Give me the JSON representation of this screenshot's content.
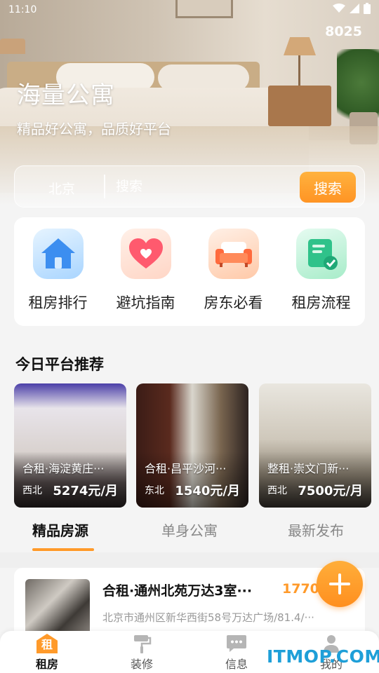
{
  "status_bar": {
    "time": "11:10"
  },
  "header": {
    "count": "8025",
    "title": "海量公寓",
    "subtitle": "精品好公寓，品质好平台"
  },
  "search": {
    "city": "北京",
    "placeholder": "搜索",
    "button_label": "搜索"
  },
  "categories": [
    {
      "label": "租房排行",
      "icon": "house-icon"
    },
    {
      "label": "避坑指南",
      "icon": "heart-icon"
    },
    {
      "label": "房东必看",
      "icon": "sofa-icon"
    },
    {
      "label": "租房流程",
      "icon": "checklist-icon"
    }
  ],
  "recommend": {
    "title": "今日平台推荐",
    "items": [
      {
        "title": "合租·海淀黄庄···",
        "direction": "西北",
        "price": "5274元/月"
      },
      {
        "title": "合租·昌平沙河···",
        "direction": "东北",
        "price": "1540元/月"
      },
      {
        "title": "整租·崇文门新···",
        "direction": "西北",
        "price": "7500元/月"
      }
    ]
  },
  "tabs": [
    {
      "label": "精品房源",
      "active": true
    },
    {
      "label": "单身公寓",
      "active": false
    },
    {
      "label": "最新发布",
      "active": false
    }
  ],
  "listing": {
    "title": "合租·通州北苑万达3室···",
    "price": "1770",
    "address": "北京市通州区新华西街58号万达广场/81.4/···"
  },
  "bottom_nav": [
    {
      "label": "租房",
      "badge": "租",
      "active": true
    },
    {
      "label": "装修",
      "active": false
    },
    {
      "label": "信息",
      "active": false
    },
    {
      "label": "我的",
      "active": false
    }
  ],
  "watermark": "ITMOP.COM",
  "colors": {
    "accent": "#ff9a2a",
    "watermark": "#1e9fd8"
  }
}
